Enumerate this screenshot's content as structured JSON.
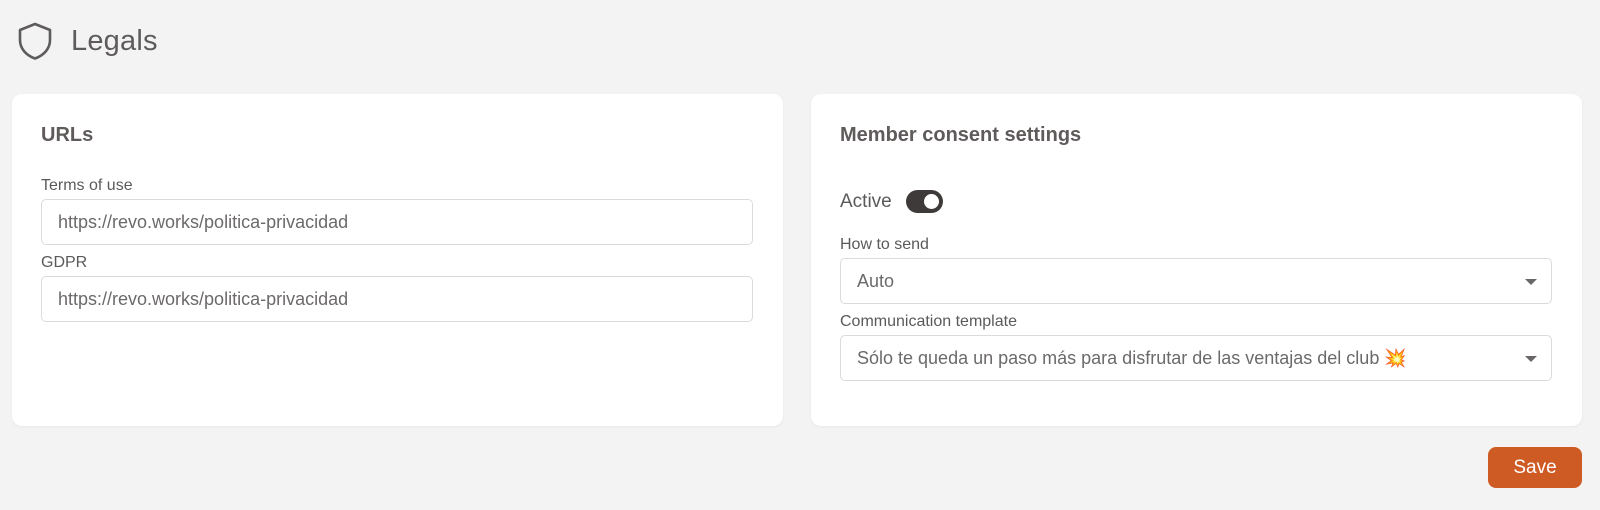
{
  "header": {
    "icon": "shield-icon",
    "title": "Legals"
  },
  "urls_card": {
    "title": "URLs",
    "terms_label": "Terms of use",
    "terms_value": "https://revo.works/politica-privacidad",
    "gdpr_label": "GDPR",
    "gdpr_value": "https://revo.works/politica-privacidad"
  },
  "consent_card": {
    "title": "Member consent settings",
    "active_label": "Active",
    "active_on": true,
    "how_to_send_label": "How to send",
    "how_to_send_value": "Auto",
    "template_label": "Communication template",
    "template_value": "Sólo te queda un paso más para disfrutar de las ventajas del club 💥"
  },
  "actions": {
    "save_label": "Save"
  },
  "colors": {
    "background": "#f4f3f4",
    "card": "#ffffff",
    "accent": "#cf5b24",
    "toggle_on": "#3f3a3a"
  }
}
